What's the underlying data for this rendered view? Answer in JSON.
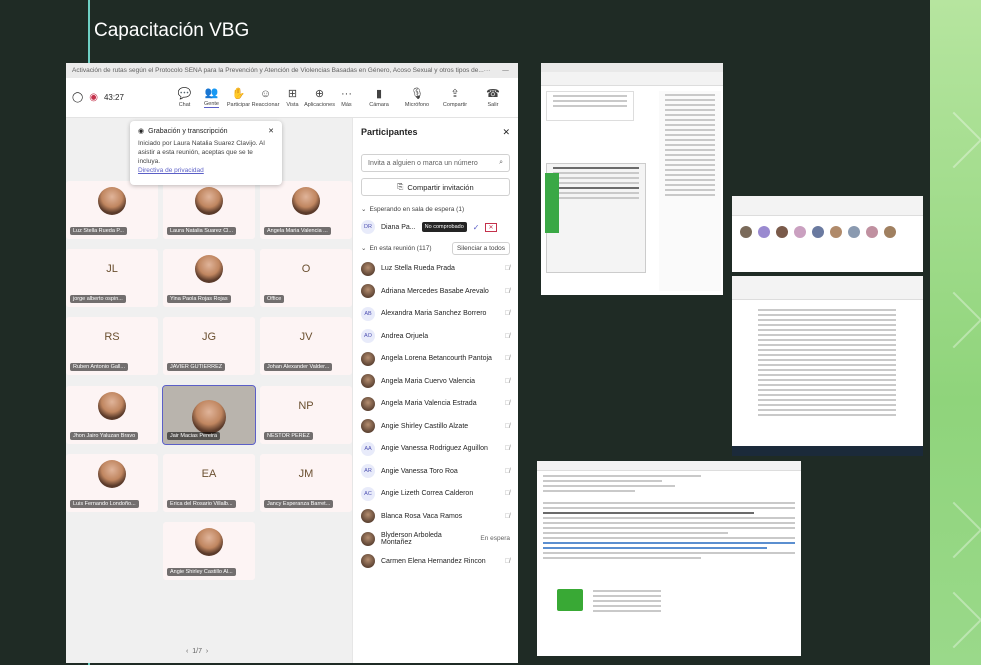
{
  "slide": {
    "title": "Capacitación VBG"
  },
  "teams": {
    "window_title": "Activación de rutas según el Protocolo SENA para la Prevención y Atención de Violencias Basadas en Género, Acoso Sexual y otros tipos de...",
    "timer": "43:27",
    "toolbar": [
      {
        "label": "Chat",
        "icon": "chat-icon"
      },
      {
        "label": "Gente",
        "icon": "people-icon"
      },
      {
        "label": "Participar",
        "icon": "raise-hand-icon"
      },
      {
        "label": "Reaccionar",
        "icon": "smile-icon"
      },
      {
        "label": "Vista",
        "icon": "grid-icon"
      },
      {
        "label": "Aplicaciones",
        "icon": "apps-icon"
      },
      {
        "label": "Más",
        "icon": "more-icon"
      },
      {
        "label": "Cámara",
        "icon": "camera-icon"
      },
      {
        "label": "Micrófono",
        "icon": "mic-icon"
      },
      {
        "label": "Compartir",
        "icon": "share-icon"
      },
      {
        "label": "Salir",
        "icon": "phone-icon"
      }
    ],
    "notice": {
      "title": "Grabación y transcripción",
      "body": "Iniciado por Laura Natalia Suarez Clavijo. Al asistir a esta reunión, aceptas que se te incluya.",
      "link": "Directiva de privacidad"
    },
    "tiles": [
      {
        "name": "Luz Stella Rueda P...",
        "initials": "",
        "kind": "avatar"
      },
      {
        "name": "Laura Natalia Suarez Cl...",
        "initials": "",
        "kind": "avatar"
      },
      {
        "name": "Angela Maria Valencia ...",
        "initials": "",
        "kind": "avatar"
      },
      {
        "name": "jorge alberto ospin...",
        "initials": "JL",
        "kind": "initials"
      },
      {
        "name": "Yina Paola Rojas Rojas",
        "initials": "",
        "kind": "avatar"
      },
      {
        "name": "Office",
        "initials": "O",
        "kind": "initials"
      },
      {
        "name": "Ruben Antonio Gall...",
        "initials": "RS",
        "kind": "initials"
      },
      {
        "name": "JAVIER GUTIERREZ",
        "initials": "JG",
        "kind": "initials"
      },
      {
        "name": "Johan Alexander Valder...",
        "initials": "JV",
        "kind": "initials"
      },
      {
        "name": "Jhon Jairo Yaluzan Bravo",
        "initials": "",
        "kind": "avatar"
      },
      {
        "name": "Jair Macias Pereira",
        "initials": "",
        "kind": "video"
      },
      {
        "name": "NESTOR PEREZ",
        "initials": "NP",
        "kind": "initials"
      },
      {
        "name": "Luis Fernando Londoño...",
        "initials": "",
        "kind": "avatar"
      },
      {
        "name": "Erica del Rosario Villalb...",
        "initials": "EA",
        "kind": "initials"
      },
      {
        "name": "Jancy Esperanza Barret...",
        "initials": "JM",
        "kind": "initials"
      },
      {
        "name": "Angie Shirley Castillo Al...",
        "initials": "",
        "kind": "avatar"
      }
    ],
    "pager": "1/7",
    "panel": {
      "title": "Participantes",
      "invite_placeholder": "Invita a alguien o marca un número",
      "share_label": "Compartir invitación",
      "waiting_section": "Esperando en sala de espera (1)",
      "waiting_person": {
        "initials": "DR",
        "name": "Diana Pa...",
        "badge": "No comprobado"
      },
      "in_meeting_section": "En esta reunión (117)",
      "mute_all": "Silenciar a todos",
      "participants": [
        {
          "name": "Luz Stella Rueda Prada",
          "initials": "",
          "status": ""
        },
        {
          "name": "Adriana Mercedes Basabe Arevalo",
          "initials": "",
          "status": ""
        },
        {
          "name": "Alexandra Maria Sanchez Borrero",
          "initials": "AB",
          "status": ""
        },
        {
          "name": "Andrea Orjuela",
          "initials": "AO",
          "status": ""
        },
        {
          "name": "Angela Lorena Betancourth Pantoja",
          "initials": "",
          "status": ""
        },
        {
          "name": "Angela Maria Cuervo Valencia",
          "initials": "",
          "status": ""
        },
        {
          "name": "Angela Maria Valencia Estrada",
          "initials": "",
          "status": ""
        },
        {
          "name": "Angie Shirley Castillo Alzate",
          "initials": "",
          "status": ""
        },
        {
          "name": "Angie Vanessa Rodriguez Aguillon",
          "initials": "AA",
          "status": ""
        },
        {
          "name": "Angie Vanessa Toro Roa",
          "initials": "AR",
          "status": ""
        },
        {
          "name": "Angie Lizeth Correa Calderon",
          "initials": "AC",
          "status": ""
        },
        {
          "name": "Blanca Rosa Vaca Ramos",
          "initials": "",
          "status": ""
        },
        {
          "name": "Blyderson Arboleda Montañez",
          "initials": "",
          "status": "En espera"
        },
        {
          "name": "Carmen Elena Hernandez Rincon",
          "initials": "",
          "status": ""
        }
      ]
    }
  },
  "colors": {
    "slide_bg": "#1f2b25",
    "accent_rule": "#6fd0c4",
    "teams_purple": "#5b5fc7",
    "leave_red": "#c4314b",
    "green_strip": "#9ad98a"
  }
}
